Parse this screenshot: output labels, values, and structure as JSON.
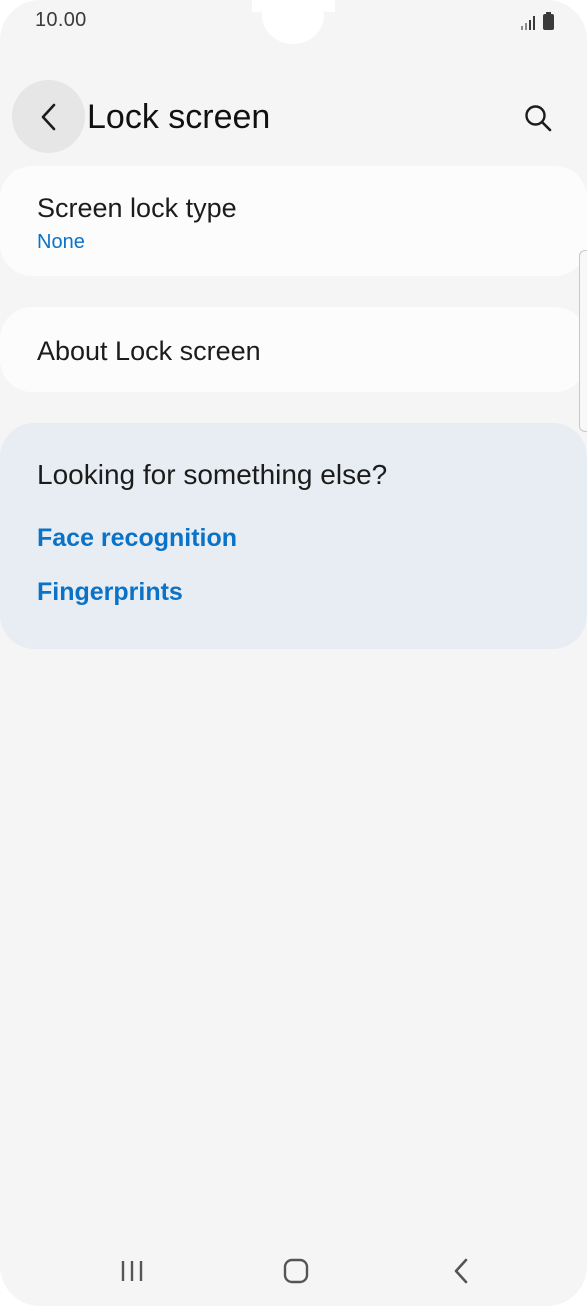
{
  "status_bar": {
    "time": "10.00",
    "icons": [
      "signal-icon",
      "battery-icon"
    ]
  },
  "app_bar": {
    "title": "Lock screen",
    "back_icon": "chevron-left-icon",
    "search_icon": "search-icon"
  },
  "settings": {
    "screen_lock_type": {
      "label": "Screen lock type",
      "value": "None"
    },
    "about": {
      "label": "About Lock screen"
    }
  },
  "suggestions": {
    "title": "Looking for something else?",
    "links": [
      "Face recognition",
      "Fingerprints"
    ]
  },
  "nav_bar": {
    "icons": [
      "recent-apps-icon",
      "home-icon",
      "back-icon"
    ]
  },
  "colors": {
    "background": "#f5f5f5",
    "card": "#fcfcfc",
    "suggestion_card": "#e8edf3",
    "accent": "#0a72c7"
  }
}
